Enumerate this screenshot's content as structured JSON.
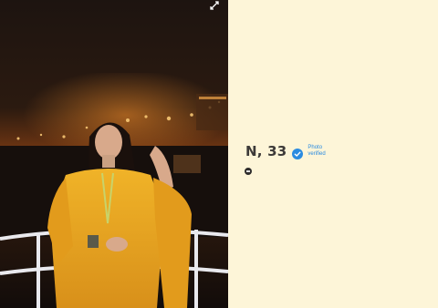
{
  "profile": {
    "name_age": "N, 33",
    "verified_label": "Photo verified"
  },
  "icons": {
    "expand": "expand-icon",
    "verified": "verified-check-icon",
    "more": "more-options-icon"
  },
  "colors": {
    "background": "#fdf5d8",
    "name_text": "#3d3a38",
    "verified_blue": "#2b8be0",
    "outfit_yellow": "#e8a81a"
  }
}
